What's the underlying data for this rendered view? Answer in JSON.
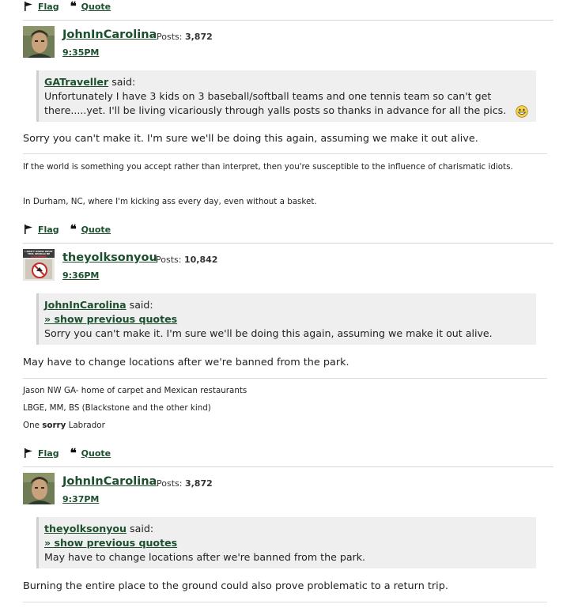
{
  "actions": {
    "flag": "Flag",
    "quote": "Quote"
  },
  "posts": [
    {
      "username": "JohnInCarolina",
      "posts_label": "Posts:",
      "post_count": "3,872",
      "time": "9:35PM",
      "quote": {
        "author": "GATraveller",
        "said": "said:",
        "text": "Unfortunately I have 3 kids on 3 baseball/softball teams and one tennis team so can't get there.....yet. I'll be living vicariously through yalls posts so thanks in advance for all the pics."
      },
      "body": "Sorry you can't make it.  I'm sure we'll be doing this again, assuming we make it out alive.",
      "signature": [
        "If the world is something you accept rather than interpret, then you're susceptible to the influence of charismatic idiots.",
        "In Durham, NC, where I'm kicking ass every day, even without a basket."
      ]
    },
    {
      "username": "theyolksonyou",
      "posts_label": "Posts:",
      "post_count": "10,842",
      "time": "9:36PM",
      "avatar_text": "I DON'T KNOW WHAT THIS SHOULD BE BUT IM SCREAMING FROM THIS PRICE",
      "quote": {
        "author": "JohnInCarolina",
        "said": "said:",
        "show_previous": "» show previous quotes",
        "text": "Sorry you can't make it.  I'm sure we'll be doing this again, assuming we make it out alive."
      },
      "body": "May have to change locations after we're banned from the park.",
      "signature": [
        "Jason NW GA- home of carpet and Mexican restaurants",
        "LBGE, MM, BS (Blackstone and the other kind)",
        "One",
        "sorry",
        "Labrador"
      ]
    },
    {
      "username": "JohnInCarolina",
      "posts_label": "Posts:",
      "post_count": "3,872",
      "time": "9:37PM",
      "quote": {
        "author": "theyolksonyou",
        "said": "said:",
        "show_previous": "» show previous quotes",
        "text": "May have to change locations after we're banned from the park."
      },
      "body": "Burning the entire place to the ground could also prove problematic to a return trip."
    }
  ]
}
